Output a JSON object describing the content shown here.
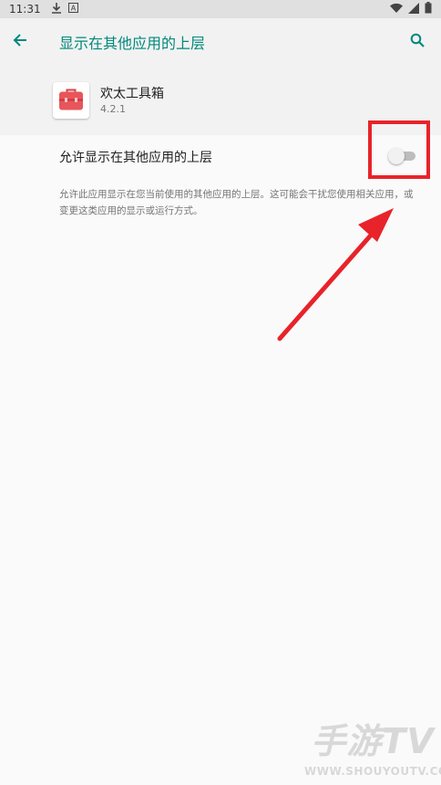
{
  "status_bar": {
    "time": "11:31",
    "download_icon": "download-icon",
    "notification_icon": "a-badge-icon",
    "wifi_icon": "wifi-icon",
    "signal_icon": "signal-icon",
    "battery_icon": "battery-icon"
  },
  "app_bar": {
    "back_icon": "arrow-back-icon",
    "title": "显示在其他应用的上层",
    "search_icon": "search-icon",
    "accent_color": "#00897b"
  },
  "app_info": {
    "icon": "toolbox-icon",
    "name": "欢太工具箱",
    "version": "4.2.1",
    "icon_color": "#e8555a"
  },
  "setting": {
    "label": "允许显示在其他应用的上层",
    "toggle_state": "off",
    "summary": "允许此应用显示在您当前使用的其他应用的上层。这可能会干扰您使用相关应用，或变更这类应用的显示或运行方式。"
  },
  "annotation": {
    "highlight_color": "#e8232a"
  },
  "watermark": {
    "brand": "手游TV",
    "url": "WWW.SHOUYOUTV.COM"
  }
}
